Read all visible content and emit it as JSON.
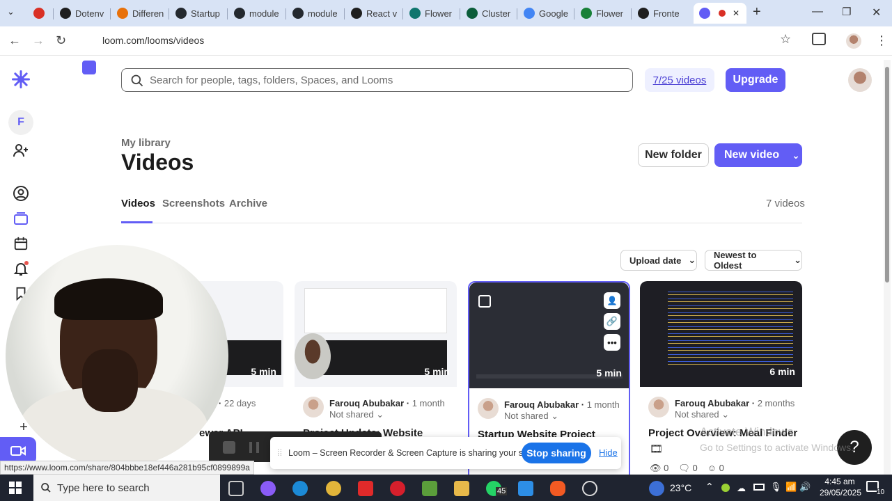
{
  "browser": {
    "tabs": [
      {
        "label": "",
        "color": "#d93025"
      },
      {
        "label": "Dotenv",
        "color": "#1f1f1f"
      },
      {
        "label": "Differen",
        "color": "#e8710a"
      },
      {
        "label": "Startup",
        "color": "#24292f"
      },
      {
        "label": "module",
        "color": "#24292f"
      },
      {
        "label": "module",
        "color": "#24292f"
      },
      {
        "label": "React v",
        "color": "#1f1f1f"
      },
      {
        "label": "Flower",
        "color": "#0f766e"
      },
      {
        "label": "Cluster",
        "color": "#0b5d3a"
      },
      {
        "label": "Google",
        "color": "#4285f4"
      },
      {
        "label": "Flower",
        "color": "#188038"
      },
      {
        "label": "Fronte",
        "color": "#1f1f1f"
      },
      {
        "label": "",
        "color": "#625df5"
      }
    ],
    "url": "loom.com/looms/videos"
  },
  "sidebar": {
    "workspace_initial": "F"
  },
  "topbar": {
    "search_placeholder": "Search for people, tags, folders, Spaces, and Looms",
    "quota": "7/25 videos",
    "upgrade": "Upgrade"
  },
  "library": {
    "breadcrumb": "My library",
    "title": "Videos",
    "new_folder": "New folder",
    "new_video": "New video",
    "tabs": [
      "Videos",
      "Screenshots",
      "Archive"
    ],
    "count": "7 videos",
    "sort_field": "Upload date",
    "sort_order": "Newest to Oldest"
  },
  "cards": [
    {
      "duration": "5 min",
      "author": "ar",
      "when": "22 days",
      "sharing": "",
      "title": "ewer API"
    },
    {
      "duration": "5 min",
      "author": "Farouq Abubakar",
      "when": "1 month",
      "sharing": "Not shared",
      "title": "Project Update: Website"
    },
    {
      "duration": "5 min",
      "author": "Farouq Abubakar",
      "when": "1 month",
      "sharing": "Not shared",
      "title": "Startup Website Project"
    },
    {
      "duration": "6 min",
      "author": "Farouq Abubakar",
      "when": "2 months",
      "sharing": "Not shared",
      "title": "Project Overview: Meal Finder"
    }
  ],
  "card_stats": [
    "0",
    "0",
    "0"
  ],
  "share_bar": {
    "message": "Loom – Screen Recorder & Screen Capture is sharing your screen.",
    "stop": "Stop sharing",
    "hide": "Hide"
  },
  "status_url": "https://www.loom.com/share/804bbbe18ef446a281b95cf0899899a",
  "watermark": {
    "line1": "Activate Windows",
    "line2": "Go to Settings to activate Windows."
  },
  "taskbar": {
    "search_placeholder": "Type here to search",
    "vscode_badge": "45",
    "temperature": "23°C",
    "time": "4:45 am",
    "date": "29/05/2025",
    "notifications": "10"
  },
  "colors": {
    "accent": "#625df5",
    "chrome": "#d8e3f5",
    "share_blue": "#1a73e8"
  }
}
